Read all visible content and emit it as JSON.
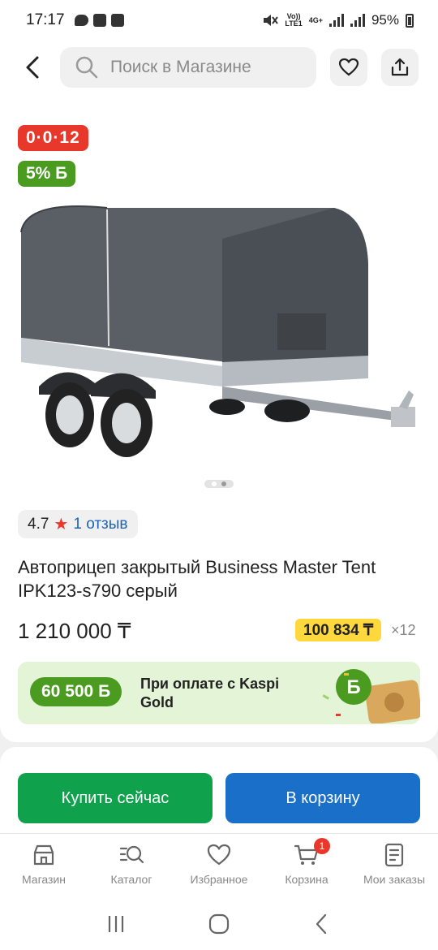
{
  "status_bar": {
    "time": "17:17",
    "volte_top": "Vo))",
    "volte_bottom": "LTE1",
    "network": "4G+",
    "battery": "95%"
  },
  "header": {
    "search_placeholder": "Поиск в Магазине"
  },
  "product": {
    "installment_badge": "0·0·12",
    "bonus_badge": "5% Б",
    "image_slides": 2,
    "active_slide": 1,
    "rating": "4.7",
    "reviews": "1 отзыв",
    "title": "Автоприцеп закрытый Business Master Tent IPK123-s790 серый",
    "price": "1 210 000 ₸",
    "monthly_price": "100 834 ₸",
    "months": "×12"
  },
  "promo": {
    "bonus_amount": "60 500 Б",
    "text": "При оплате с Kaspi Gold"
  },
  "actions": {
    "buy_now": "Купить сейчас",
    "add_to_cart": "В корзину"
  },
  "bottom_nav": {
    "items": [
      {
        "label": "Магазин",
        "icon": "store-icon"
      },
      {
        "label": "Каталог",
        "icon": "catalog-search-icon"
      },
      {
        "label": "Избранное",
        "icon": "heart-icon"
      },
      {
        "label": "Корзина",
        "icon": "cart-icon",
        "badge": "1"
      },
      {
        "label": "Мои заказы",
        "icon": "orders-icon"
      }
    ]
  },
  "colors": {
    "red": "#e8372b",
    "green": "#4b9b21",
    "buy_green": "#0fa14c",
    "blue": "#1a6fc9",
    "yellow": "#ffd83d"
  }
}
